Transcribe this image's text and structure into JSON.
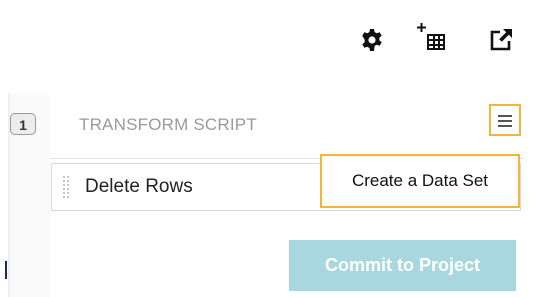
{
  "toolbar": {
    "icons": [
      "gear-icon",
      "add-table-icon",
      "export-icon"
    ]
  },
  "panel": {
    "step_number": "1",
    "title": "TRANSFORM SCRIPT",
    "menu_icon": "hamburger-menu-icon",
    "steps": [
      {
        "label": "Delete Rows"
      }
    ],
    "tooltip": "Create a Data Set",
    "commit_label": "Commit to Project"
  },
  "colors": {
    "highlight": "#f2b43a",
    "commit_bg": "#a8d7df",
    "title_gray": "#9a9a9a"
  }
}
